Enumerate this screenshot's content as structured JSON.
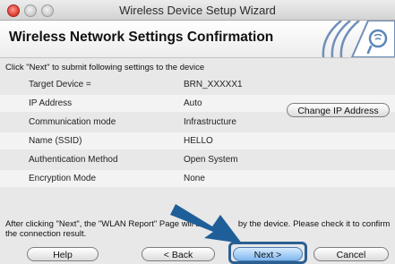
{
  "window": {
    "title": "Wireless Device Setup Wizard"
  },
  "header": {
    "title": "Wireless Network Settings Confirmation"
  },
  "instruction": "Click \"Next\" to submit following settings to the device",
  "settings": [
    {
      "label": "Target Device =",
      "value": "BRN_XXXXX1"
    },
    {
      "label": "IP Address",
      "value": "Auto"
    },
    {
      "label": "Communication mode",
      "value": "Infrastructure"
    },
    {
      "label": "Name (SSID)",
      "value": "HELLO"
    },
    {
      "label": "Authentication Method",
      "value": "Open System"
    },
    {
      "label": "Encryption Mode",
      "value": "None"
    }
  ],
  "buttons": {
    "change_ip": "Change IP Address",
    "help": "Help",
    "back": "< Back",
    "next": "Next >",
    "cancel": "Cancel"
  },
  "note_a": "After clicking \"Next\", the \"WLAN Report\" Page will b",
  "note_b": "by the device. Please check it to confirm",
  "note_line2": "the connection result.",
  "colors": {
    "accent_blue": "#2b5f92",
    "header_logo_blue": "#5b86b8"
  }
}
